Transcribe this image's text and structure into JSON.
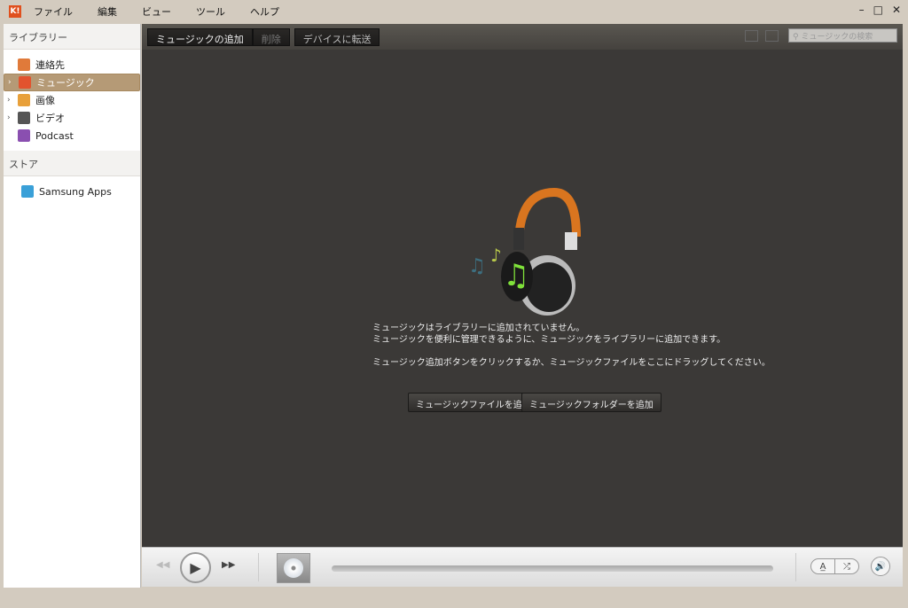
{
  "menubar": {
    "logo": "K!",
    "items": [
      "ファイル",
      "編集",
      "ビュー",
      "ツール",
      "ヘルプ"
    ],
    "window_controls": [
      "–",
      "□",
      "✕"
    ]
  },
  "sidebar": {
    "library_title": "ライブラリー",
    "library_items": [
      {
        "label": "連絡先",
        "icon": "contacts-icon",
        "expandable": false,
        "selected": false,
        "color": "#e07a3a"
      },
      {
        "label": "ミュージック",
        "icon": "music-icon",
        "expandable": true,
        "selected": true,
        "color": "#e2532e"
      },
      {
        "label": "画像",
        "icon": "image-folder-icon",
        "expandable": true,
        "selected": false,
        "color": "#e8a03a"
      },
      {
        "label": "ビデオ",
        "icon": "film-reel-icon",
        "expandable": true,
        "selected": false,
        "color": "#555555"
      },
      {
        "label": "Podcast",
        "icon": "podcast-icon",
        "expandable": false,
        "selected": false,
        "color": "#8a4fb0"
      }
    ],
    "store_title": "ストア",
    "store_items": [
      {
        "label": "Samsung Apps",
        "icon": "samsung-apps-icon",
        "color": "#3aa0d8"
      }
    ]
  },
  "toolbar": {
    "add_music": "ミュージックの追加",
    "delete": "削除",
    "transfer": "デバイスに転送",
    "search_placeholder": "ミュージックの検索"
  },
  "empty": {
    "line1": "ミュージックはライブラリーに追加されていません。",
    "line2": "ミュージックを便利に管理できるように、ミュージックをライブラリーに追加できます。",
    "line3": "ミュージック追加ボタンをクリックするか、ミュージックファイルをここにドラッグしてください。",
    "add_file": "ミュージックファイルを追加",
    "add_folder": "ミュージックフォルダーを追加"
  },
  "player": {
    "progress": 0
  }
}
